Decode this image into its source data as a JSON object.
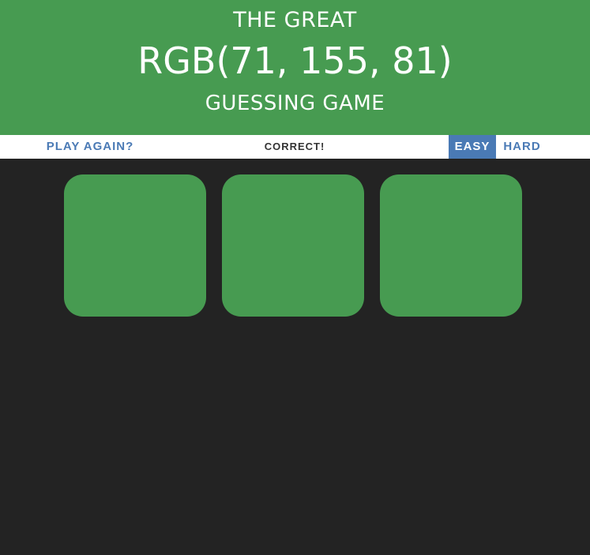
{
  "header": {
    "line1": "THE GREAT",
    "color_display": "RGB(71, 155, 81)",
    "line3": "GUESSING GAME",
    "background": "#479b51"
  },
  "stripe": {
    "reset_label": "PLAY AGAIN?",
    "message": "CORRECT!",
    "easy_label": "EASY",
    "hard_label": "HARD",
    "selected_mode": "EASY",
    "accent": "#4a7ab5"
  },
  "squares": [
    {
      "color": "#479b51"
    },
    {
      "color": "#479b51"
    },
    {
      "color": "#479b51"
    }
  ],
  "page_background": "#232323"
}
